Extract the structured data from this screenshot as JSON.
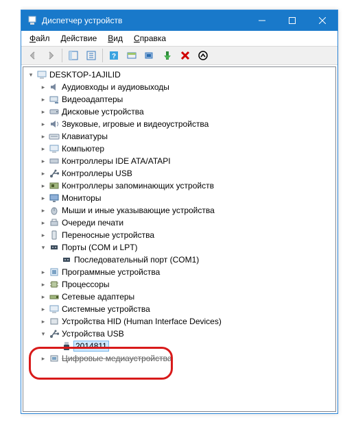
{
  "window": {
    "title": "Диспетчер устройств"
  },
  "menu": {
    "file": "Файл",
    "action": "Действие",
    "view": "Вид",
    "help": "Справка"
  },
  "tree": {
    "root": "DESKTOP-1AJILID",
    "nodes": {
      "audio": "Аудиовходы и аудиовыходы",
      "video": "Видеоадаптеры",
      "disk": "Дисковые устройства",
      "sound": "Звуковые, игровые и видеоустройства",
      "keyboard": "Клавиатуры",
      "computer": "Компьютер",
      "ide": "Контроллеры IDE ATA/ATAPI",
      "usb_ctrl": "Контроллеры USB",
      "storage_ctrl": "Контроллеры запоминающих устройств",
      "monitors": "Мониторы",
      "mice": "Мыши и иные указывающие устройства",
      "print_queues": "Очереди печати",
      "portable": "Переносные устройства",
      "ports": "Порты (COM и LPT)",
      "serial_port": "Последовательный порт (COM1)",
      "software": "Программные устройства",
      "cpu": "Процессоры",
      "net": "Сетевые адаптеры",
      "system": "Системные устройства",
      "hid": "Устройства HID (Human Interface Devices)",
      "usb_dev": "Устройства USB",
      "usb_item": "2014811",
      "media_dev": "Цифровые медиаустройства"
    }
  }
}
